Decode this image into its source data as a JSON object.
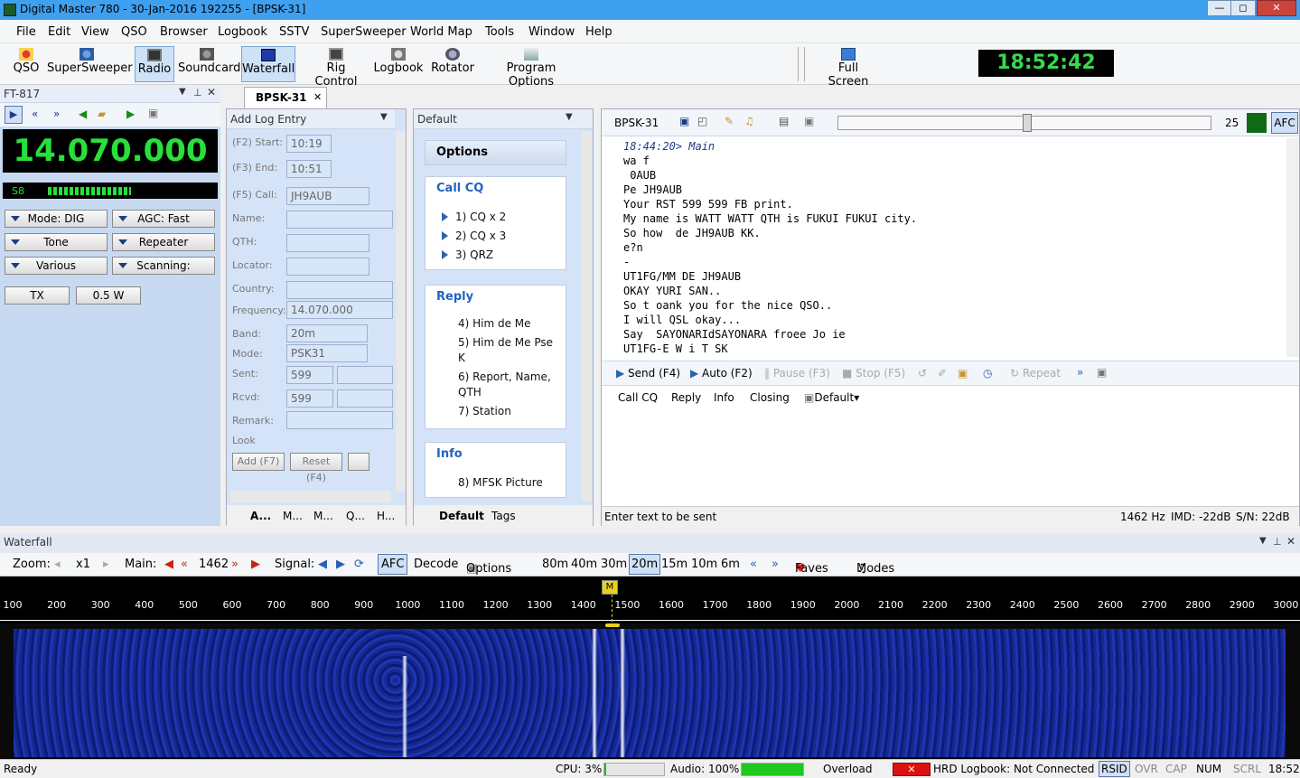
{
  "window": {
    "title": "Digital Master 780 - 30-Jan-2016 192255 - [BPSK-31]",
    "min": "—",
    "max": "◻",
    "close": "✕"
  },
  "menu": [
    "File",
    "Edit",
    "View",
    "QSO",
    "Browser",
    "Logbook",
    "SSTV",
    "SuperSweeper",
    "World Map",
    "Tools",
    "Window",
    "Help"
  ],
  "toolbar": {
    "qso": "QSO",
    "supersweeper": "SuperSweeper",
    "radio": "Radio",
    "soundcard": "Soundcard",
    "waterfall": "Waterfall",
    "rig": "Rig Control",
    "logbook": "Logbook",
    "rotator": "Rotator",
    "options": "Program Options",
    "fullscreen": "Full Screen",
    "clock": "18:52:42"
  },
  "radio": {
    "title": "FT-817",
    "frequency": "14.070.000",
    "smeter": "S8",
    "mode": "Mode: DIG",
    "agc": "AGC: Fast",
    "tone": "Tone",
    "repeater": "Repeater",
    "various": "Various",
    "scanning": "Scanning:",
    "tx": "TX",
    "power": "0.5 W"
  },
  "doctab": {
    "label": "BPSK-31",
    "close": "✕"
  },
  "log": {
    "title": "Add Log Entry",
    "start_label": "(F2) Start:",
    "start": "10:19",
    "end_label": "(F3) End:",
    "end": "10:51",
    "call_label": "(F5) Call:",
    "call": "JH9AUB",
    "name_label": "Name:",
    "qth_label": "QTH:",
    "locator_label": "Locator:",
    "country_label": "Country:",
    "freq_label": "Frequency:",
    "freq": "14.070.000",
    "band_label": "Band:",
    "band": "20m",
    "mode_label": "Mode:",
    "mode": "PSK31",
    "sent_label": "Sent:",
    "sent": "599",
    "rcvd_label": "Rcvd:",
    "rcvd": "599",
    "remark_label": "Remark:",
    "look_label": "Look",
    "add": "Add (F7)",
    "reset": "Reset (F4)",
    "tabs": [
      "A...",
      "M...",
      "M...",
      "Q...",
      "H..."
    ]
  },
  "macros": {
    "title": "Default",
    "options": "Options",
    "callcq": "Call CQ",
    "reply": "Reply",
    "info": "Info",
    "items": [
      "1)  CQ x 2",
      "2)  CQ x 3",
      "3)  QRZ",
      "4)  Him de Me",
      "5)  Him de Me Pse",
      "K",
      "6)  Report, Name,",
      "QTH",
      "7)  Station",
      "8)  MFSK Picture"
    ],
    "tab_default": "Default",
    "tab_tags": "Tags"
  },
  "psk": {
    "mode": "BPSK-31",
    "level": "25",
    "afc": "AFC",
    "rx_lines": [
      "18:44:20> Main",
      "wa f",
      " 0AUB",
      "Pe JH9AUB",
      "Your RST 599 599 FB print.",
      "My name is WATT WATT QTH is FUKUI FUKUI city.",
      "So how  de JH9AUB KK.",
      "e?n",
      "-",
      "UT1FG/MM DE JH9AUB",
      "OKAY YURI SAN..",
      "So t oank you for the nice QSO..",
      "I will QSL okay...",
      "Say  SAYONARIdSAYONARA froee Jo ie",
      "UT1FG-E W i T SK"
    ],
    "send": "Send",
    "send_key": "(F4)",
    "auto": "Auto",
    "auto_key": "(F2)",
    "pause": "Pause",
    "pause_key": "(F3)",
    "stop": "Stop",
    "stop_key": "(F5)",
    "repeat": "Repeat",
    "macro_callcq": "Call CQ",
    "macro_reply": "Reply",
    "macro_info": "Info",
    "macro_closing": "Closing",
    "macro_default": "Default",
    "tx_hint": "Enter text to be sent",
    "hz": "1462 Hz",
    "imd": "IMD: -22dB",
    "sn": "S/N: 22dB"
  },
  "waterfall": {
    "title": "Waterfall",
    "zoom_label": "Zoom:",
    "zoom": "x1",
    "main_label": "Main:",
    "main": "1462",
    "signal_label": "Signal:",
    "afc": "AFC",
    "decode": "Decode",
    "options": "Options",
    "bands": [
      "80m",
      "40m",
      "30m",
      "20m",
      "15m",
      "10m",
      "6m"
    ],
    "faves": "Faves",
    "modes": "Modes",
    "marker": "M",
    "ticks": [
      "100",
      "200",
      "300",
      "400",
      "500",
      "600",
      "700",
      "800",
      "900",
      "1000",
      "1100",
      "1200",
      "1300",
      "1400",
      "1500",
      "1600",
      "1700",
      "1800",
      "1900",
      "2000",
      "2100",
      "2200",
      "2300",
      "2400",
      "2500",
      "2600",
      "2700",
      "2800",
      "2900",
      "3000"
    ]
  },
  "status": {
    "ready": "Ready",
    "cpu": "CPU: 3%",
    "audio": "Audio: 100%",
    "overload": "Overload",
    "hrd": "HRD Logbook: Not Connected",
    "rsid": "RSID",
    "ovr": "OVR",
    "cap": "CAP",
    "num": "NUM",
    "scrl": "SCRL",
    "time": "18:52"
  }
}
